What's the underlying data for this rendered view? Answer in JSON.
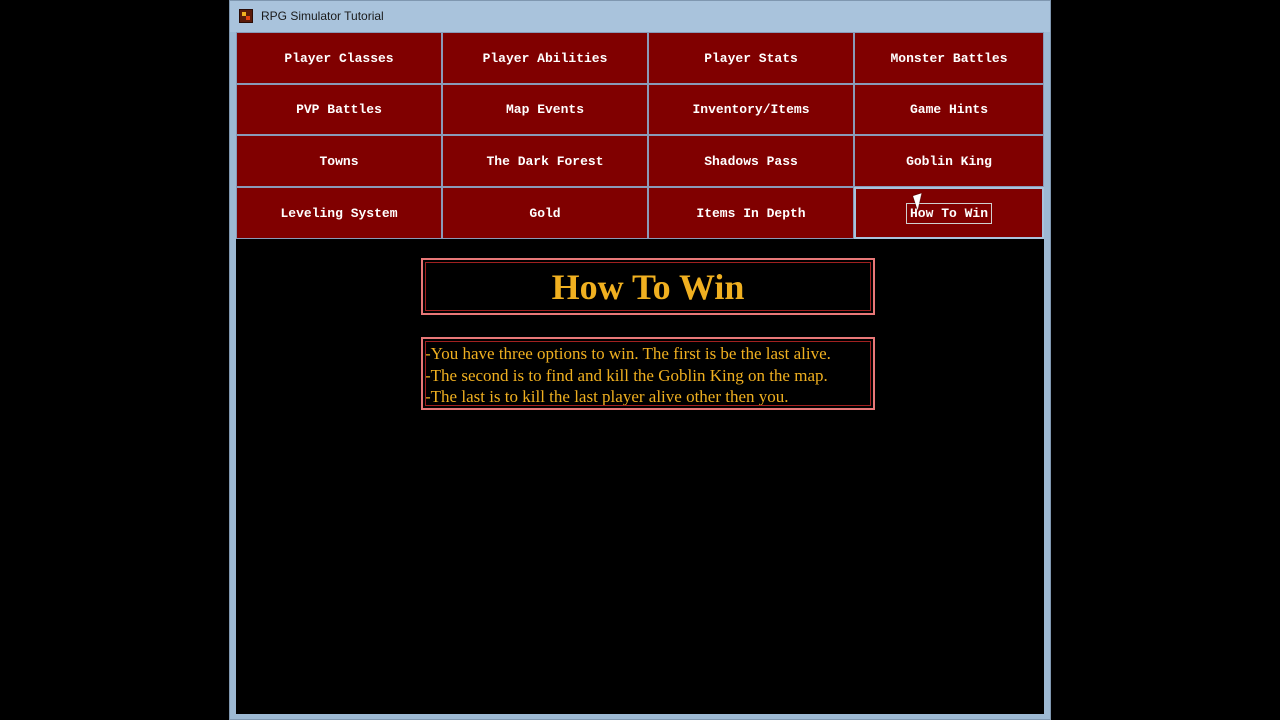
{
  "window": {
    "title": "RPG Simulator Tutorial"
  },
  "nav": {
    "buttons": [
      {
        "label": "Player Classes"
      },
      {
        "label": "Player Abilities"
      },
      {
        "label": "Player Stats"
      },
      {
        "label": "Monster Battles"
      },
      {
        "label": "PVP Battles"
      },
      {
        "label": "Map Events"
      },
      {
        "label": "Inventory/Items"
      },
      {
        "label": "Game Hints"
      },
      {
        "label": "Towns"
      },
      {
        "label": "The Dark Forest"
      },
      {
        "label": "Shadows Pass"
      },
      {
        "label": "Goblin King"
      },
      {
        "label": "Leveling System"
      },
      {
        "label": "Gold"
      },
      {
        "label": "Items In Depth"
      },
      {
        "label": "How To Win"
      }
    ],
    "active": "How To Win"
  },
  "content": {
    "title": "How To Win",
    "lines": [
      "-You have three options to win. The first is be the last alive.",
      "-The second is to find and kill the Goblin King on the map.",
      "-The last is to kill the last player alive other then you."
    ]
  },
  "colors": {
    "button_bg": "#800000",
    "text_gold": "#f0b020",
    "box_border": "#e87878",
    "titlebar": "#a9c3dc"
  }
}
